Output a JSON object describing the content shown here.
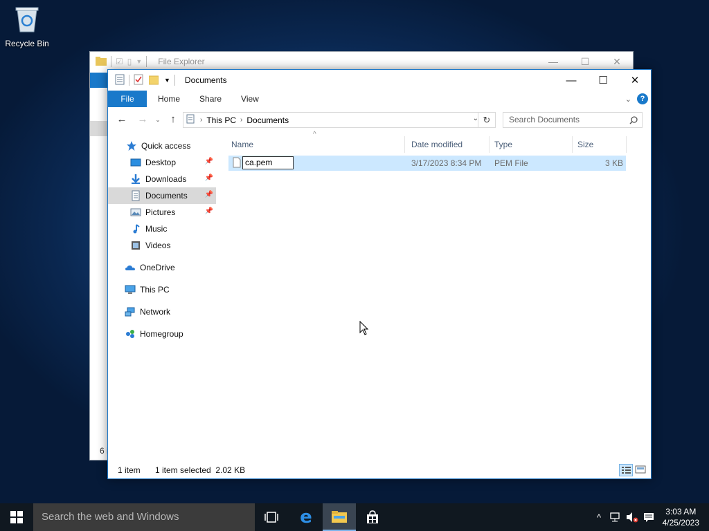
{
  "desktop": {
    "recycle_bin_label": "Recycle Bin"
  },
  "back_window": {
    "title": "File Explorer",
    "status_count": "6 i"
  },
  "window": {
    "title": "Documents",
    "ribbon_tabs": {
      "file": "File",
      "home": "Home",
      "share": "Share",
      "view": "View"
    },
    "help": "?",
    "address": {
      "root": "This PC",
      "current": "Documents"
    },
    "search_placeholder": "Search Documents",
    "nav": {
      "quick_access": "Quick access",
      "desktop": "Desktop",
      "downloads": "Downloads",
      "documents": "Documents",
      "pictures": "Pictures",
      "music": "Music",
      "videos": "Videos",
      "onedrive": "OneDrive",
      "this_pc": "This PC",
      "network": "Network",
      "homegroup": "Homegroup"
    },
    "columns": {
      "name": "Name",
      "date": "Date modified",
      "type": "Type",
      "size": "Size"
    },
    "files": [
      {
        "name": "ca.pem",
        "date": "3/17/2023 8:34 PM",
        "type": "PEM File",
        "size": "3 KB"
      }
    ],
    "status": {
      "count": "1 item",
      "selected": "1 item selected  2.02 KB"
    }
  },
  "taskbar": {
    "search_placeholder": "Search the web and Windows",
    "time": "3:03 AM",
    "date": "4/25/2023"
  },
  "colors": {
    "accent": "#1979ca",
    "selection": "#cce8ff",
    "taskbar": "#101820"
  }
}
